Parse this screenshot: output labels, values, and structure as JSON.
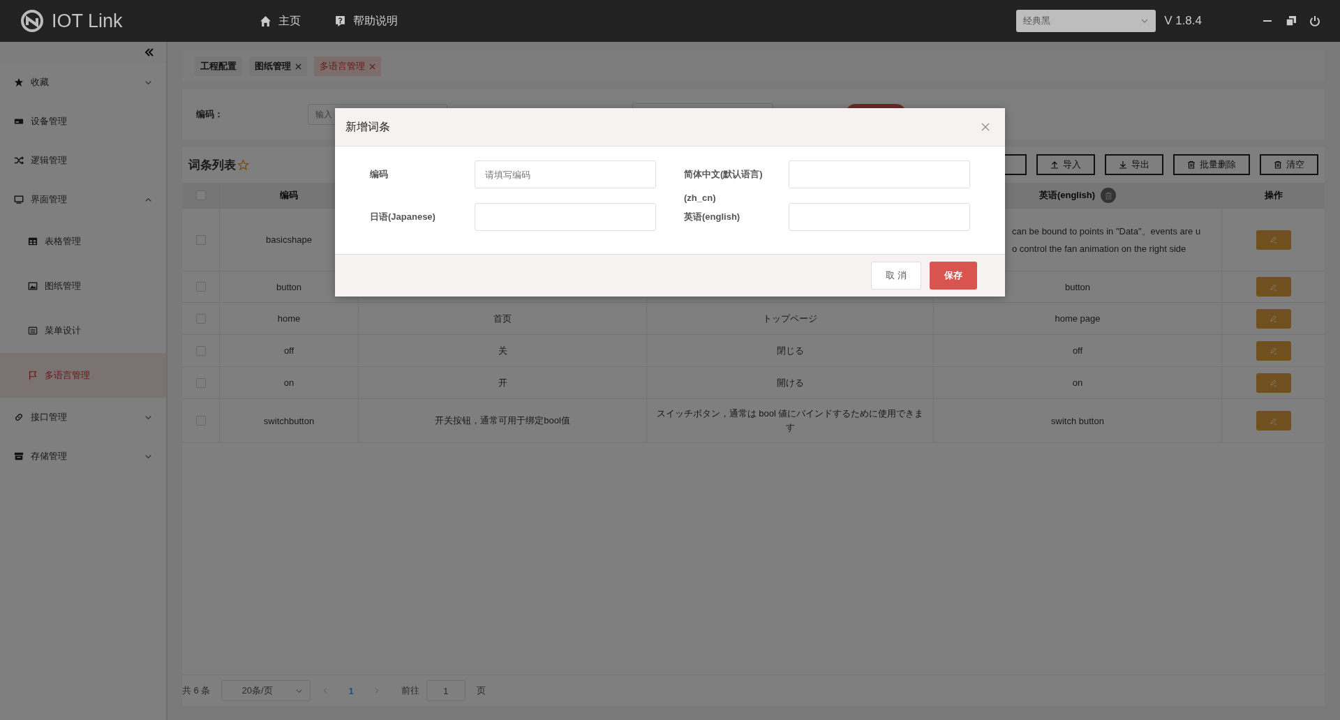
{
  "app": {
    "title": "IOT Link",
    "theme_select": {
      "value": "经典黑"
    },
    "version": "V 1.8.4"
  },
  "nav": [
    {
      "label": "主页"
    },
    {
      "label": "帮助说明"
    }
  ],
  "sidebar": {
    "items": [
      {
        "label": "收藏",
        "expanded": false,
        "selected": false
      },
      {
        "label": "设备管理",
        "selected": false
      },
      {
        "label": "逻辑管理",
        "selected": false
      },
      {
        "label": "界面管理",
        "expanded": true,
        "selected": false,
        "children": [
          {
            "label": "表格管理",
            "selected": false
          },
          {
            "label": "图纸管理",
            "selected": false
          },
          {
            "label": "菜单设计",
            "selected": false
          },
          {
            "label": "多语言管理",
            "selected": true
          }
        ]
      },
      {
        "label": "接口管理",
        "expanded": false,
        "selected": false
      },
      {
        "label": "存储管理",
        "expanded": false,
        "selected": false
      }
    ]
  },
  "tabs": [
    {
      "label": "工程配置",
      "closable": false,
      "selected": false
    },
    {
      "label": "图纸管理",
      "closable": true,
      "selected": false
    },
    {
      "label": "多语言管理",
      "closable": true,
      "selected": true
    }
  ],
  "filter": {
    "label": "编码：",
    "placeholder": "输入"
  },
  "list_title": "词条列表",
  "toolbar": [
    {
      "label": "导入"
    },
    {
      "label": "导出"
    },
    {
      "label": "批量删除"
    },
    {
      "label": "清空"
    }
  ],
  "table": {
    "columns": {
      "code": "编码",
      "english": "英语(english)",
      "actions": "操作"
    },
    "all_selected": false,
    "rows": [
      {
        "selected": false,
        "code": "basicshape",
        "english_lines": [
          "can be bound to points in \"Data\"。events are u",
          "o control the fan animation on the right side"
        ]
      },
      {
        "selected": false,
        "code": "button",
        "english": "button"
      },
      {
        "selected": false,
        "code": "home",
        "zh": "首页",
        "ja": "トップページ",
        "english": "home page"
      },
      {
        "selected": false,
        "code": "off",
        "zh": "关",
        "ja": "閉じる",
        "english": "off"
      },
      {
        "selected": false,
        "code": "on",
        "zh": "开",
        "ja": "開ける",
        "english": "on"
      },
      {
        "selected": false,
        "code": "switchbutton",
        "zh": "开关按钮，通常可用于绑定bool值",
        "ja": "スイッチボタン，通常は bool 値にバインドするために使用できます",
        "english": "switch button"
      }
    ]
  },
  "pagination": {
    "total": "共 6 条",
    "page_size": "20条/页",
    "pages": [
      {
        "label": "1",
        "selected": true
      }
    ],
    "goto_label": "前往",
    "goto_value": "1",
    "page_suffix": "页"
  },
  "dialog": {
    "title": "新增词条",
    "fields": [
      {
        "label": "编码",
        "placeholder": "请填写编码"
      },
      {
        "label": "简体中文(默认语言)(zh_cn)"
      },
      {
        "label": "日语(Japanese)"
      },
      {
        "label": "英语(english)"
      }
    ],
    "buttons": [
      {
        "label": "取 消",
        "kind": "default"
      },
      {
        "label": "保存",
        "kind": "primary"
      }
    ]
  }
}
